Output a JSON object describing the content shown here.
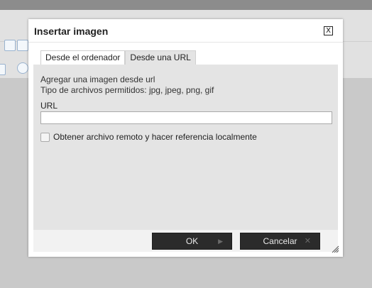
{
  "dialog": {
    "title": "Insertar imagen",
    "close_label": "X",
    "tabs": [
      {
        "label": "Desde el ordenador",
        "active": false
      },
      {
        "label": "Desde una URL",
        "active": true
      }
    ],
    "info": {
      "line1": "Agregar una imagen desde url",
      "line2": "Tipo de archivos permitidos: jpg, jpeg, png, gif"
    },
    "url": {
      "label": "URL",
      "value": "",
      "placeholder": ""
    },
    "remote": {
      "label": "Obtener archivo remoto y hacer referencia localmente",
      "checked": false
    },
    "buttons": {
      "ok_label": "OK",
      "ok_icon": "arrow-right-icon",
      "cancel_label": "Cancelar",
      "cancel_icon": "close-icon"
    }
  },
  "colors": {
    "overlay": "#bdbdbd",
    "panel": "#e4e4e4",
    "button_bg": "#2b2b2b",
    "button_text": "#e8e8e8"
  }
}
